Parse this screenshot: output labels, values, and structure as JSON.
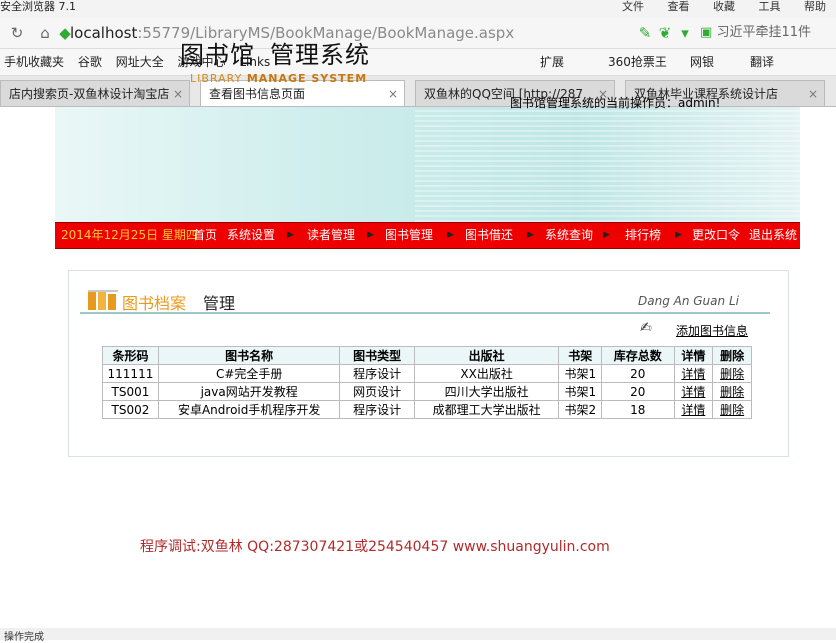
{
  "browser": {
    "window_title": "安全浏览器 7.1",
    "menus": [
      "文件",
      "查看",
      "收藏",
      "工具",
      "帮助"
    ],
    "url_host": "localhost",
    "url_rest": ":55779/LibraryMS/BookManage/BookManage.aspx",
    "search_text": "习近平牵挂11件",
    "bookmarks": [
      "手机收藏夹",
      "谷歌",
      "网址大全",
      "游戏中心",
      "Links"
    ],
    "bookmarks_right": [
      "扩展",
      "360抢票王",
      "网银",
      "翻译"
    ],
    "tabs": [
      {
        "label": "店内搜索页-双鱼林设计淘宝店"
      },
      {
        "label": "查看图书信息页面"
      },
      {
        "label": "双鱼林的QQ空间 [http://287"
      },
      {
        "label": "双鱼林毕业课程系统设计店"
      }
    ],
    "status_text": "操作完成"
  },
  "header": {
    "logo_part1": "图书馆",
    "logo_part2": "管理系统",
    "logo_en_1": "LIBRARY",
    "logo_en_2": "MANAGE SYSTEM",
    "operator_label": "图书馆管理系统的当前操作员：admin!"
  },
  "nav": {
    "date": "2014年12月25日 星期四",
    "items": [
      "首页",
      "系统设置",
      "读者管理",
      "图书管理",
      "图书借还",
      "系统查询",
      "排行榜",
      "更改口令",
      "退出系统"
    ]
  },
  "panel": {
    "title_colored": "图书档案",
    "title_rest": "管理",
    "title_right": "Dang An Guan Li",
    "add_link": "添加图书信息"
  },
  "table": {
    "headers": [
      "条形码",
      "图书名称",
      "图书类型",
      "出版社",
      "书架",
      "库存总数",
      "详情",
      "删除"
    ],
    "rows": [
      [
        "111111",
        "C#完全手册",
        "程序设计",
        "XX出版社",
        "书架1",
        "20",
        "详情",
        "删除"
      ],
      [
        "TS001",
        "java网站开发教程",
        "网页设计",
        "四川大学出版社",
        "书架1",
        "20",
        "详情",
        "删除"
      ],
      [
        "TS002",
        "安卓Android手机程序开发",
        "程序设计",
        "成都理工大学出版社",
        "书架2",
        "18",
        "详情",
        "删除"
      ]
    ]
  },
  "footer": {
    "text": "程序调试:双鱼林 QQ:287307421或254540457 www.shuangyulin.com"
  },
  "colors": {
    "nav_red": "#e00000",
    "date_yellow": "#ffcc33",
    "footer_red": "#b22a2a",
    "title_orange": "#e89a1e"
  }
}
